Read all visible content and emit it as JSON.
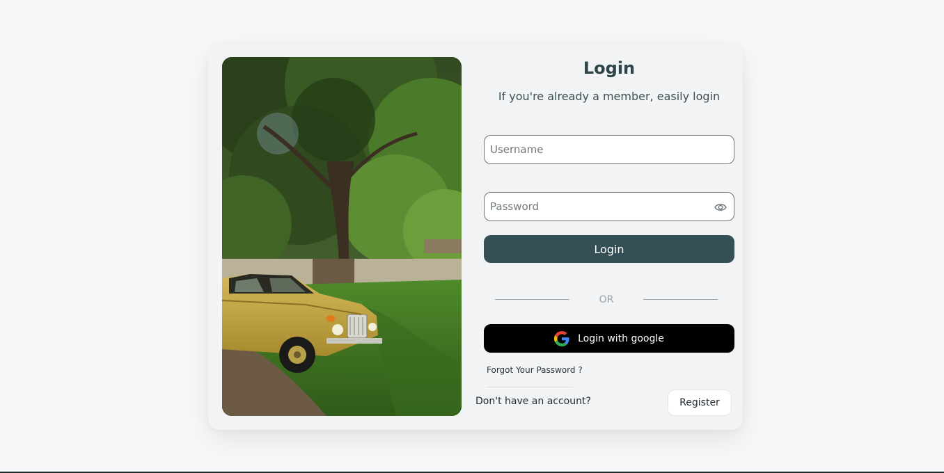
{
  "login": {
    "title": "Login",
    "subtitle": "If you're already a member, easily login",
    "username_placeholder": "Username",
    "password_placeholder": "Password",
    "login_button": "Login",
    "divider_text": "OR",
    "google_button": "Login with google",
    "forgot_password": "Forgot Your Password ?",
    "no_account_text": "Don't have an account?",
    "register_button": "Register"
  },
  "icons": {
    "password_toggle": "eye-icon",
    "google": "google-icon"
  },
  "colors": {
    "page_background": "#f6f8fa",
    "card_background": "#f1f3f5",
    "primary_button": "#344f55",
    "google_button": "#000000",
    "title_text": "#2d4448"
  }
}
